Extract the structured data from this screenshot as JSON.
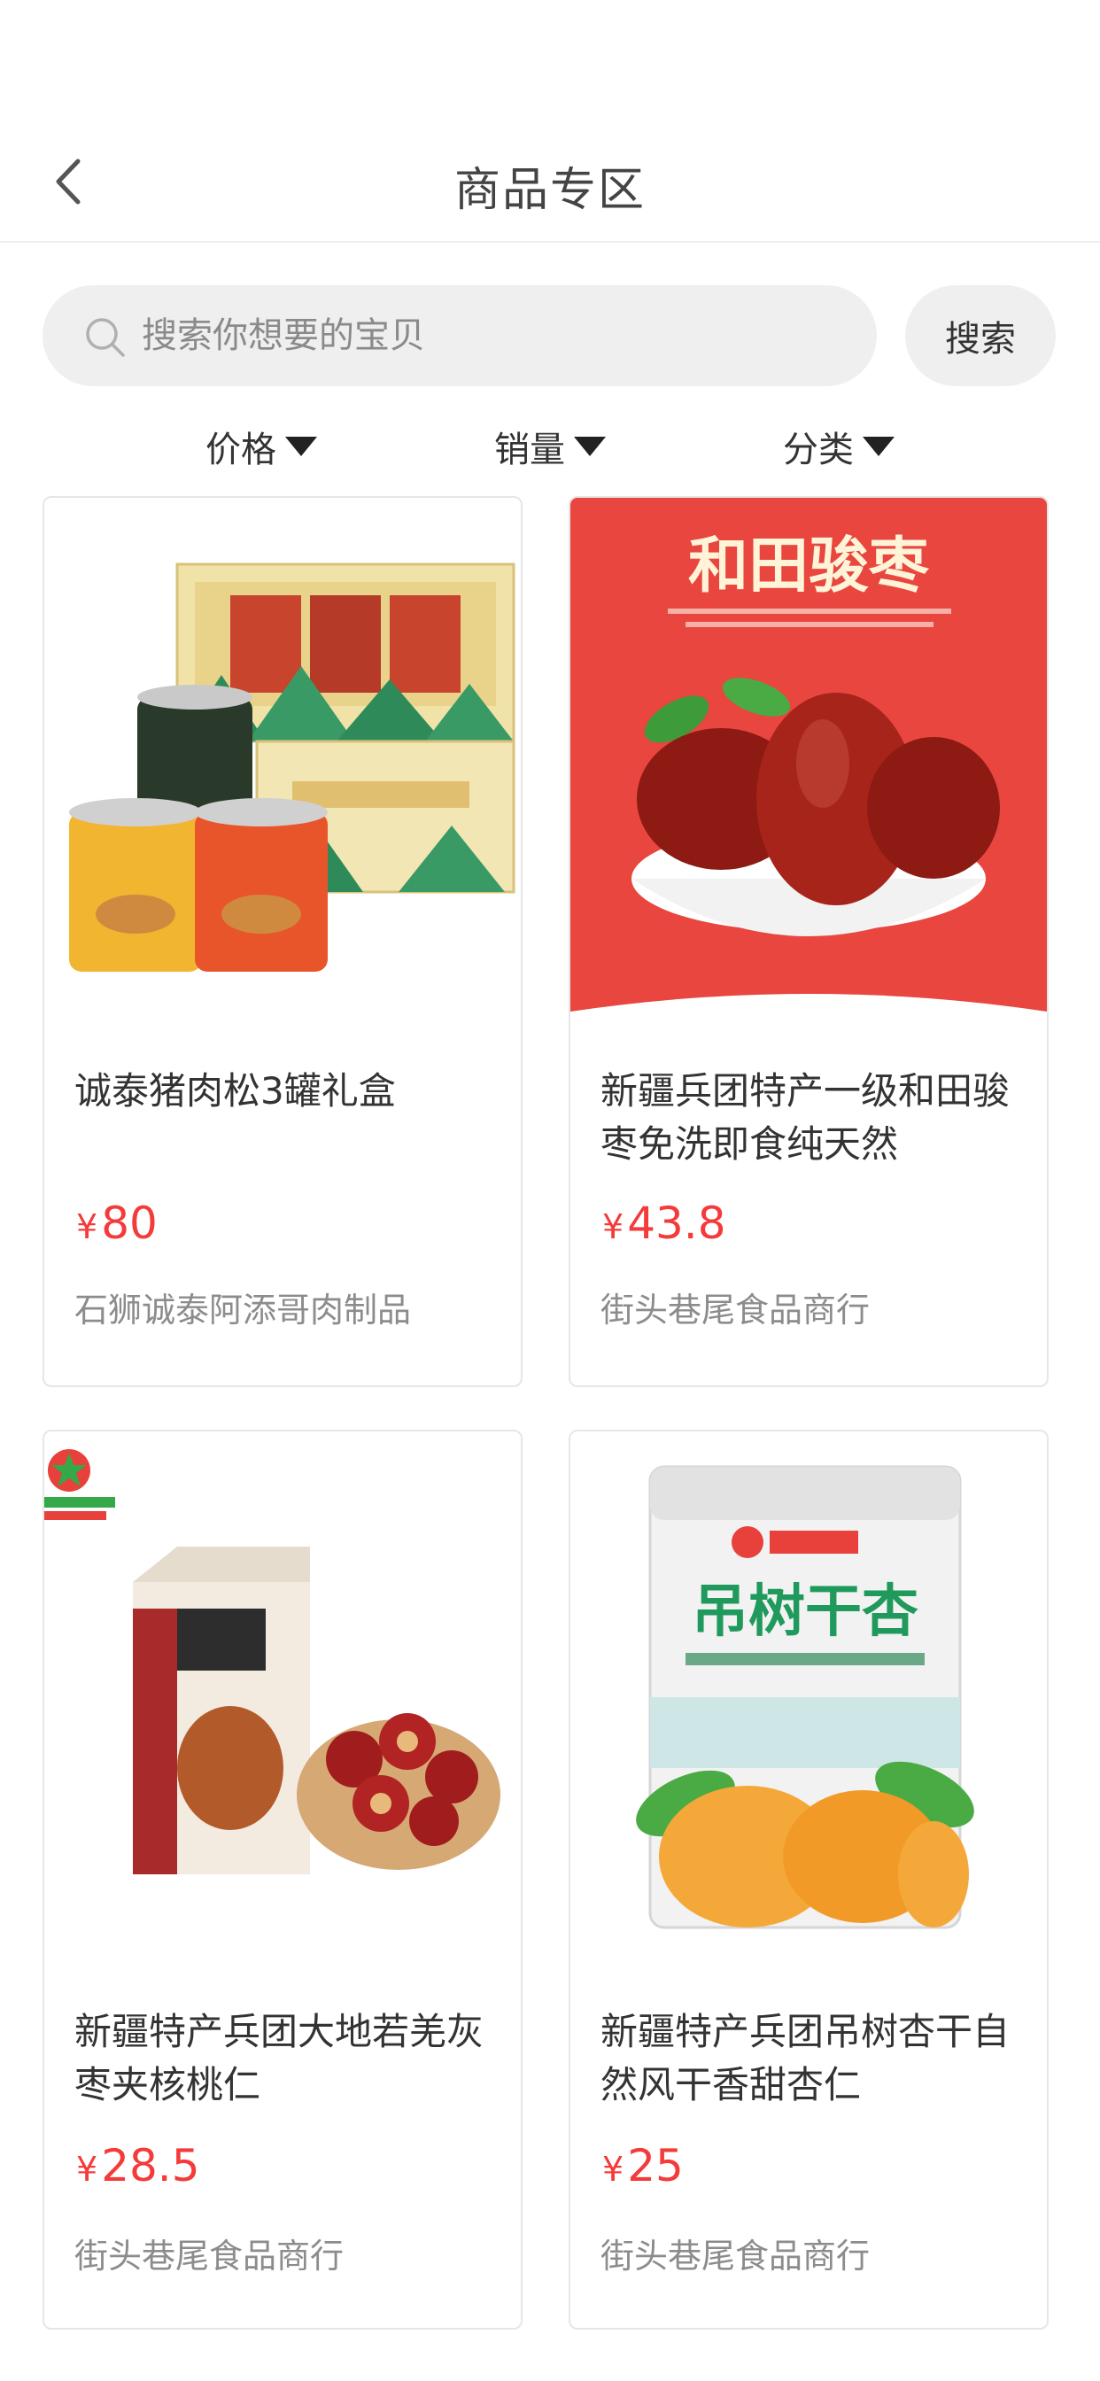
{
  "header": {
    "title": "商品专区"
  },
  "search": {
    "placeholder": "搜索你想要的宝贝",
    "button_label": "搜索"
  },
  "filters": [
    {
      "label": "价格"
    },
    {
      "label": "销量"
    },
    {
      "label": "分类"
    }
  ],
  "products": [
    {
      "name": "诚泰猪肉松3罐礼盒",
      "currency": "¥",
      "price": "80",
      "shop": "石狮诚泰阿添哥肉制品",
      "image_icon": "pork-floss-giftbox-image"
    },
    {
      "name": "新疆兵团特产一级和田骏枣免洗即食纯天然",
      "currency": "¥",
      "price": "43.8",
      "shop": "街头巷尾食品商行",
      "image_icon": "hetian-jujube-image",
      "image_text": "和田骏枣"
    },
    {
      "name": "新疆特产兵团大地若羌灰枣夹核桃仁",
      "currency": "¥",
      "price": "28.5",
      "shop": "街头巷尾食品商行",
      "image_icon": "jujube-walnut-image"
    },
    {
      "name": "新疆特产兵团吊树杏干自然风干香甜杏仁",
      "currency": "¥",
      "price": "25",
      "shop": "街头巷尾食品商行",
      "image_icon": "dried-apricot-bag-image",
      "image_text": "吊树干杏"
    }
  ],
  "colors": {
    "price": "#f53a3a",
    "search_bg": "#efefef",
    "border": "#e6e6e6"
  }
}
